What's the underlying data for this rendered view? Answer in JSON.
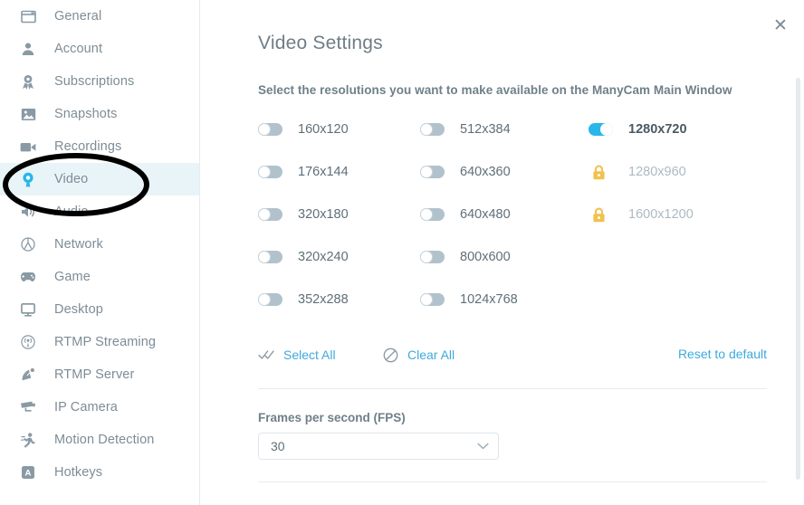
{
  "sidebar": {
    "items": [
      {
        "label": "General",
        "icon": "window-icon",
        "active": false
      },
      {
        "label": "Account",
        "icon": "person-icon",
        "active": false
      },
      {
        "label": "Subscriptions",
        "icon": "award-ribbon-icon",
        "active": false
      },
      {
        "label": "Snapshots",
        "icon": "image-icon",
        "active": false
      },
      {
        "label": "Recordings",
        "icon": "video-camera-icon",
        "active": false
      },
      {
        "label": "Video",
        "icon": "webcam-icon",
        "active": true
      },
      {
        "label": "Audio",
        "icon": "speaker-icon",
        "active": false
      },
      {
        "label": "Network",
        "icon": "globe-icon",
        "active": false
      },
      {
        "label": "Game",
        "icon": "gamepad-icon",
        "active": false
      },
      {
        "label": "Desktop",
        "icon": "monitor-icon",
        "active": false
      },
      {
        "label": "RTMP Streaming",
        "icon": "broadcast-icon",
        "active": false
      },
      {
        "label": "RTMP Server",
        "icon": "satellite-dish-icon",
        "active": false
      },
      {
        "label": "IP Camera",
        "icon": "cctv-camera-icon",
        "active": false
      },
      {
        "label": "Motion Detection",
        "icon": "running-person-icon",
        "active": false
      },
      {
        "label": "Hotkeys",
        "icon": "key-a-icon",
        "active": false
      }
    ]
  },
  "panel": {
    "title": "Video Settings",
    "subtitle": "Select the resolutions you want to make available on the ManyCam Main Window",
    "close_label": "✕"
  },
  "resolutions": {
    "columns": [
      [
        {
          "label": "160x120",
          "state": "off"
        },
        {
          "label": "176x144",
          "state": "off"
        },
        {
          "label": "320x180",
          "state": "off"
        },
        {
          "label": "320x240",
          "state": "off"
        },
        {
          "label": "352x288",
          "state": "off"
        }
      ],
      [
        {
          "label": "512x384",
          "state": "off"
        },
        {
          "label": "640x360",
          "state": "off"
        },
        {
          "label": "640x480",
          "state": "off"
        },
        {
          "label": "800x600",
          "state": "off"
        },
        {
          "label": "1024x768",
          "state": "off"
        }
      ],
      [
        {
          "label": "1280x720",
          "state": "on"
        },
        {
          "label": "1280x960",
          "state": "locked"
        },
        {
          "label": "1600x1200",
          "state": "locked"
        },
        {
          "label": "",
          "state": "empty"
        },
        {
          "label": "",
          "state": "empty"
        }
      ]
    ]
  },
  "actions": {
    "select_all": "Select All",
    "clear_all": "Clear All",
    "reset": "Reset to default"
  },
  "fps": {
    "label": "Frames per second (FPS)",
    "value": "30"
  },
  "colors": {
    "accent_blue": "#29b6e8",
    "link_blue": "#3fa9dd",
    "lock_amber": "#f2c14e",
    "toggle_off": "#b2c2cc",
    "active_row_bg": "#e9f4f9",
    "text_muted": "#7e8c96",
    "annotation": "#000000"
  }
}
